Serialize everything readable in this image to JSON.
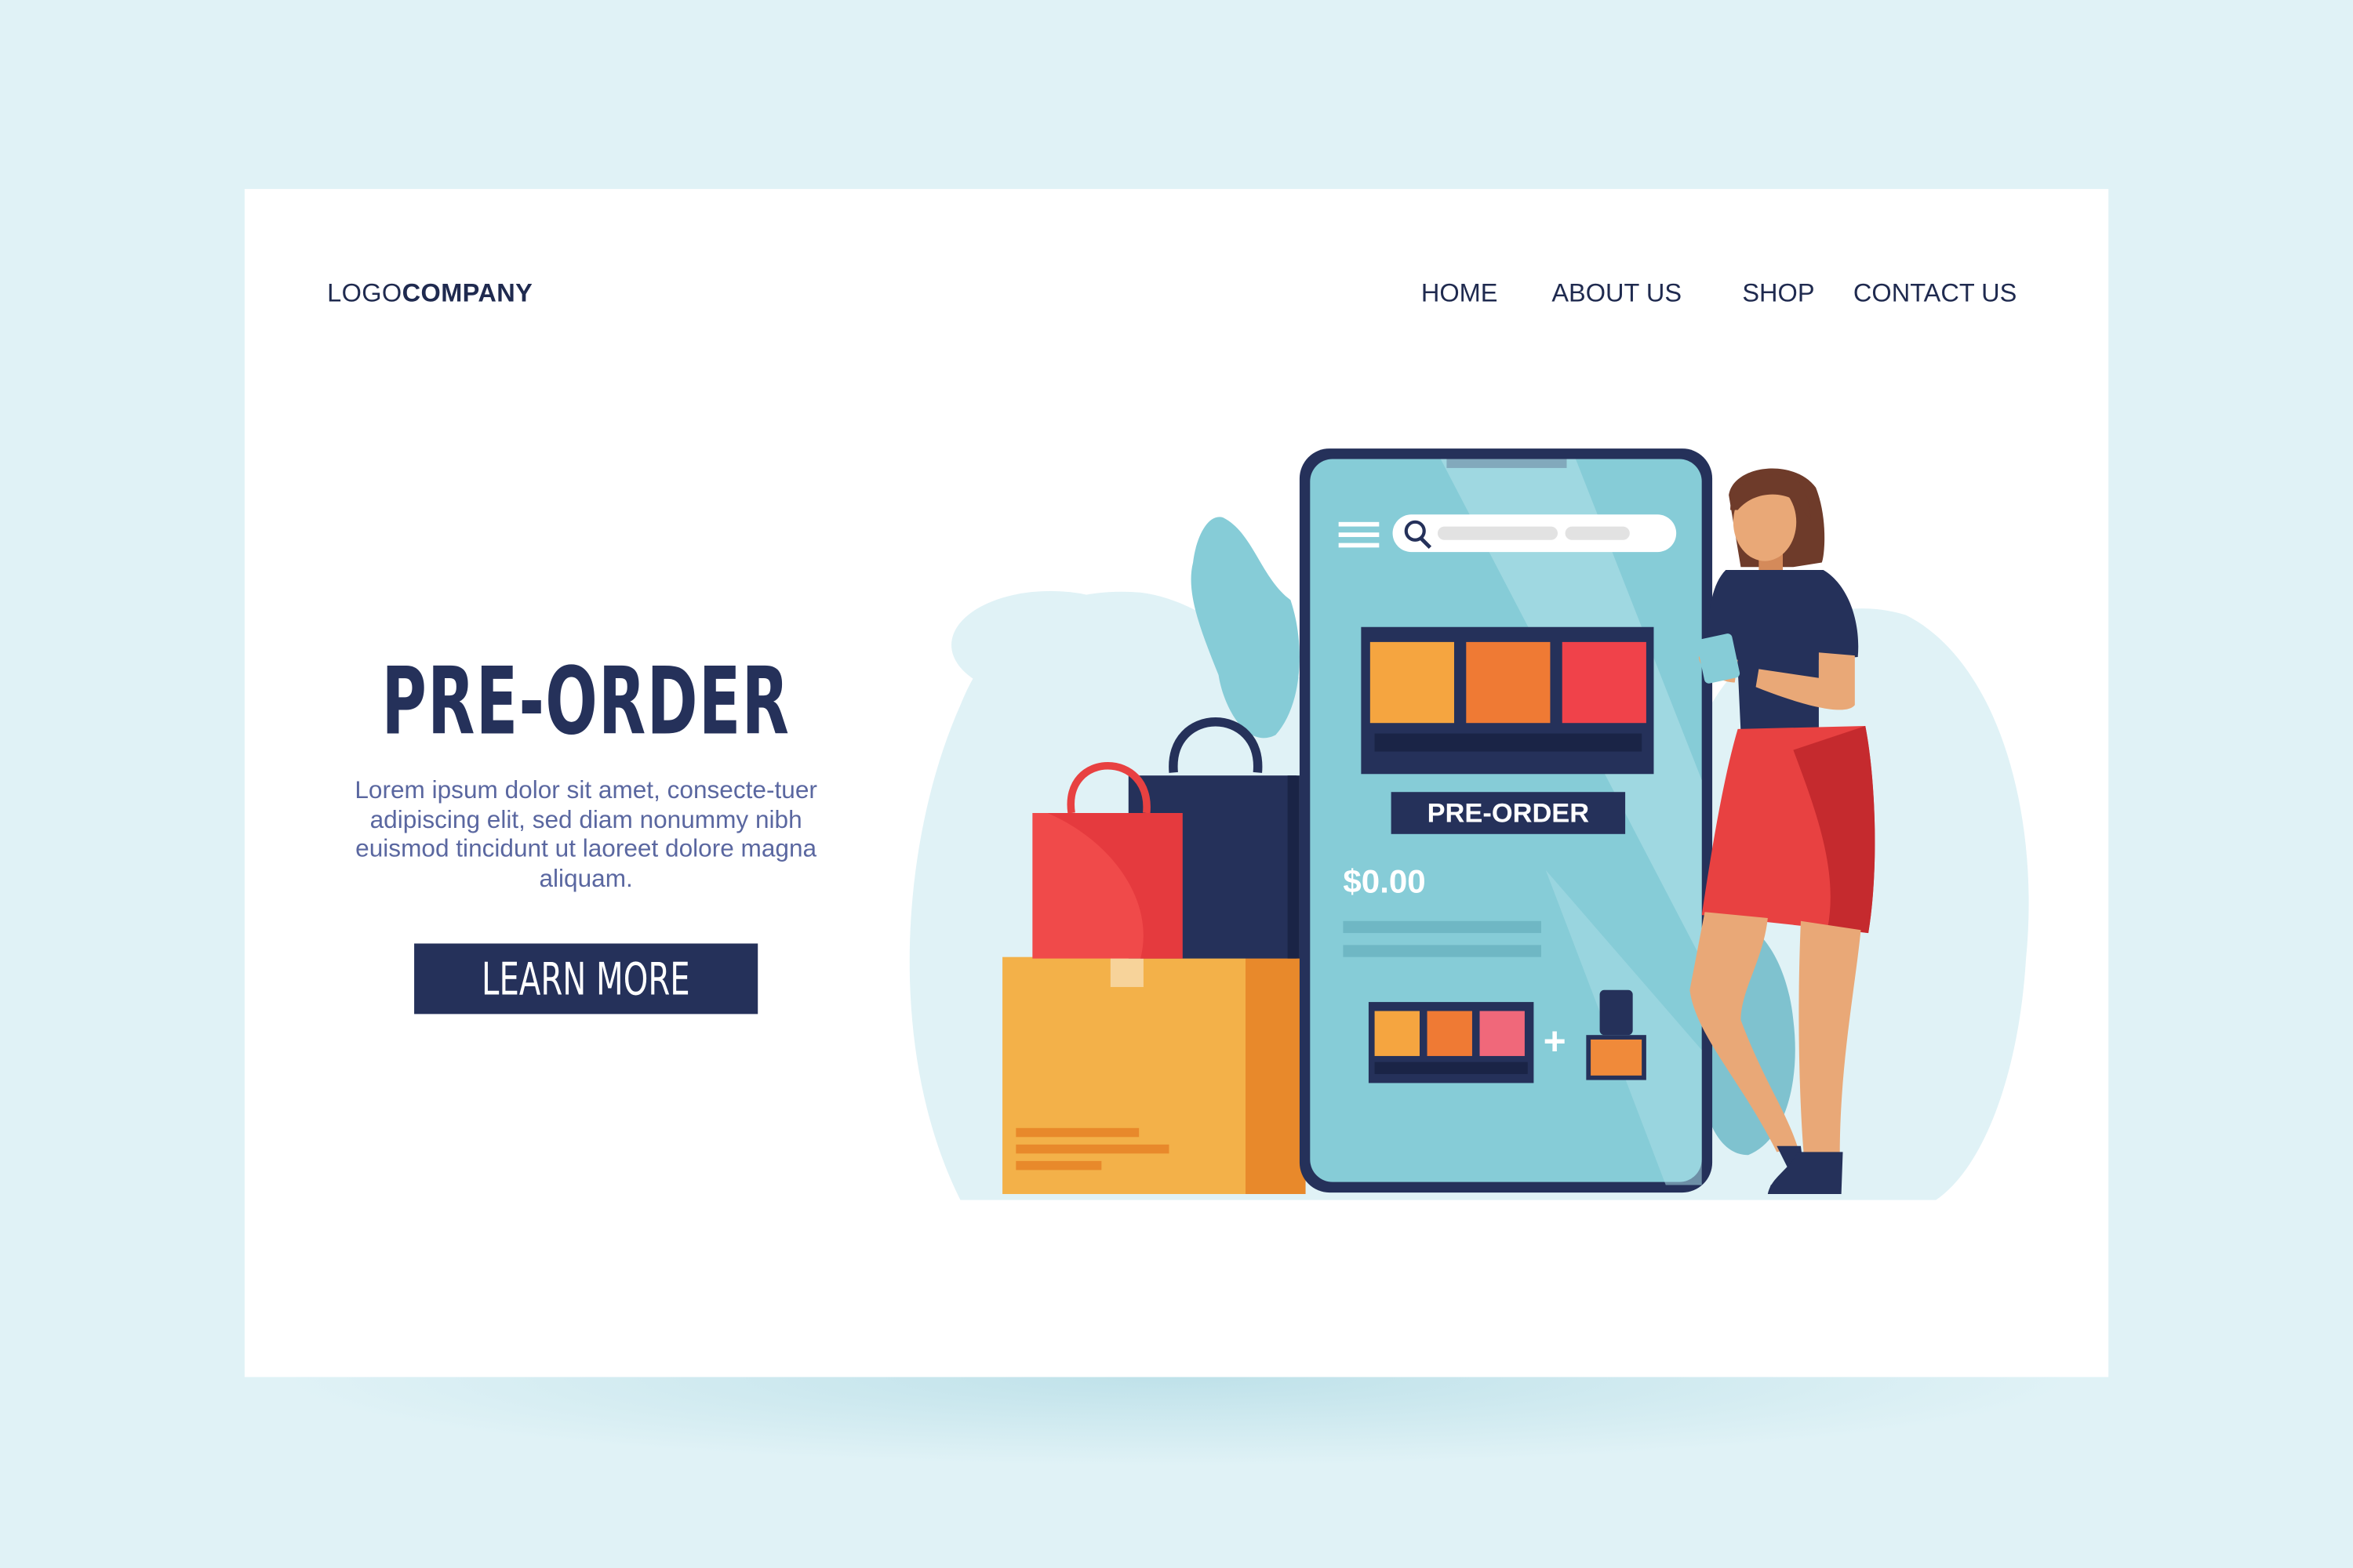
{
  "header": {
    "logo_light": "LOGO",
    "logo_bold": "COMPANY",
    "nav": [
      {
        "label": "HOME"
      },
      {
        "label": "ABOUT US"
      },
      {
        "label": "SHOP"
      },
      {
        "label": "CONTACT US"
      }
    ]
  },
  "hero": {
    "title": "PRE-ORDER",
    "description": "Lorem ipsum dolor sit amet, consecte-tuer adipiscing elit, sed diam nonummy nibh euismod tincidunt ut laoreet dolore magna aliquam.",
    "button_label": "LEARN MORE"
  },
  "phone_screen": {
    "badge_label": "PRE-ORDER",
    "price": "$0.00",
    "plus_sign": "+"
  },
  "colors": {
    "navy": "#25315a",
    "page_bg": "#e0f2f6",
    "screen_blue": "#86ccd7",
    "accent_red": "#e84141",
    "accent_orange": "#f0a64a"
  }
}
